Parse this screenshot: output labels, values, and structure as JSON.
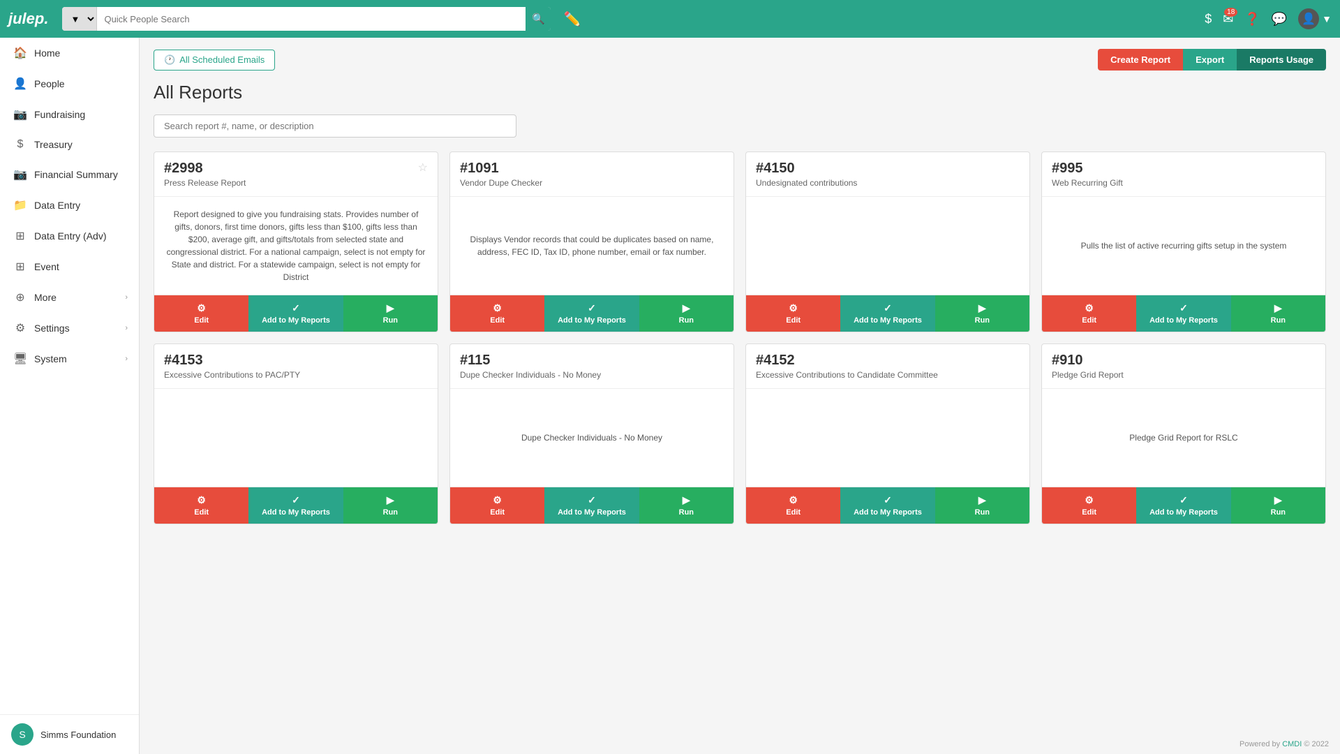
{
  "header": {
    "logo": "julep.",
    "search_placeholder": "Quick People Search",
    "search_dropdown_label": "▼",
    "badge_count": "18",
    "icons": [
      "$",
      "✉",
      "?",
      "🔍",
      "👤"
    ]
  },
  "sidebar": {
    "items": [
      {
        "id": "home",
        "label": "Home",
        "icon": "🏠",
        "active": false,
        "arrow": false
      },
      {
        "id": "people",
        "label": "People",
        "icon": "👤",
        "active": false,
        "arrow": false
      },
      {
        "id": "fundraising",
        "label": "Fundraising",
        "icon": "📷",
        "active": false,
        "arrow": false
      },
      {
        "id": "treasury",
        "label": "Treasury",
        "icon": "$",
        "active": false,
        "arrow": false
      },
      {
        "id": "financial-summary",
        "label": "Financial Summary",
        "icon": "📷",
        "active": false,
        "arrow": false
      },
      {
        "id": "data-entry",
        "label": "Data Entry",
        "icon": "📁",
        "active": false,
        "arrow": false
      },
      {
        "id": "data-entry-adv",
        "label": "Data Entry (Adv)",
        "icon": "⊞",
        "active": false,
        "arrow": false
      },
      {
        "id": "event",
        "label": "Event",
        "icon": "⊞",
        "active": false,
        "arrow": false
      },
      {
        "id": "more",
        "label": "More",
        "icon": "⊕",
        "active": false,
        "arrow": true
      },
      {
        "id": "settings",
        "label": "Settings",
        "icon": "⚙",
        "active": false,
        "arrow": true
      },
      {
        "id": "system",
        "label": "System",
        "icon": "🖥",
        "active": false,
        "arrow": true
      }
    ],
    "user": "Simms Foundation"
  },
  "toolbar": {
    "scheduled_emails_label": "All Scheduled Emails",
    "create_report_label": "Create Report",
    "export_label": "Export",
    "reports_usage_label": "Reports Usage"
  },
  "page": {
    "title": "All Reports",
    "search_placeholder": "Search report #, name, or description"
  },
  "cards": [
    {
      "number": "#2998",
      "name": "Press Release Report",
      "description": "Report designed to give you fundraising stats. Provides number of gifts, donors, first time donors, gifts less than $100, gifts less than $200, average gift, and gifts/totals from selected state and congressional district. For a national campaign, select is not empty for State and district. For a statewide campaign, select is not empty for District",
      "has_star": true
    },
    {
      "number": "#1091",
      "name": "Vendor Dupe Checker",
      "description": "Displays Vendor records that could be duplicates based on name, address, FEC ID, Tax ID, phone number, email or fax number.",
      "has_star": false
    },
    {
      "number": "#4150",
      "name": "Undesignated contributions",
      "description": "",
      "has_star": false
    },
    {
      "number": "#995",
      "name": "Web Recurring Gift",
      "description": "Pulls the list of active recurring gifts setup in the system",
      "has_star": false
    },
    {
      "number": "#4153",
      "name": "Excessive Contributions to PAC/PTY",
      "description": "",
      "has_star": false
    },
    {
      "number": "#115",
      "name": "Dupe Checker Individuals - No Money",
      "description": "Dupe Checker Individuals - No Money",
      "has_star": false
    },
    {
      "number": "#4152",
      "name": "Excessive Contributions to Candidate Committee",
      "description": "",
      "has_star": false
    },
    {
      "number": "#910",
      "name": "Pledge Grid Report",
      "description": "Pledge Grid Report for RSLC",
      "has_star": false
    }
  ],
  "card_buttons": {
    "edit": "Edit",
    "add": "Add to My Reports",
    "run": "Run"
  },
  "footer": {
    "powered_by": "Powered by",
    "cmdi": "CMDI",
    "year": "© 2022"
  }
}
